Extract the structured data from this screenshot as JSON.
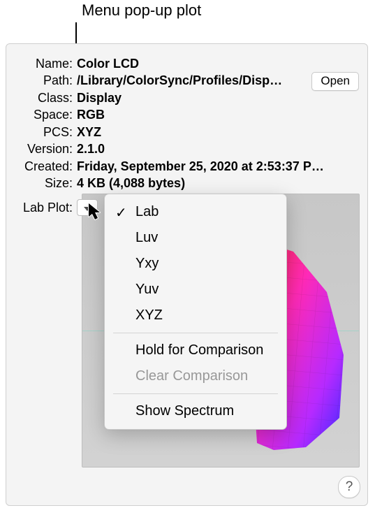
{
  "annotation": "Menu pop-up plot",
  "info": {
    "name_label": "Name:",
    "name_value": "Color LCD",
    "path_label": "Path:",
    "path_value": "/Library/ColorSync/Profiles/Disp…",
    "class_label": "Class:",
    "class_value": "Display",
    "space_label": "Space:",
    "space_value": "RGB",
    "pcs_label": "PCS:",
    "pcs_value": "XYZ",
    "version_label": "Version:",
    "version_value": "2.1.0",
    "created_label": "Created:",
    "created_value": "Friday, September 25, 2020 at 2:53:37 P…",
    "size_label": "Size:",
    "size_value": "4 KB (4,088 bytes)"
  },
  "open_button": "Open",
  "lab_plot_label": "Lab Plot:",
  "menu": {
    "items": [
      {
        "label": "Lab",
        "checked": true,
        "disabled": false
      },
      {
        "label": "Luv",
        "checked": false,
        "disabled": false
      },
      {
        "label": "Yxy",
        "checked": false,
        "disabled": false
      },
      {
        "label": "Yuv",
        "checked": false,
        "disabled": false
      },
      {
        "label": "XYZ",
        "checked": false,
        "disabled": false
      }
    ],
    "hold": "Hold for Comparison",
    "clear": "Clear Comparison",
    "show": "Show Spectrum",
    "clear_disabled": true
  },
  "help": "?"
}
